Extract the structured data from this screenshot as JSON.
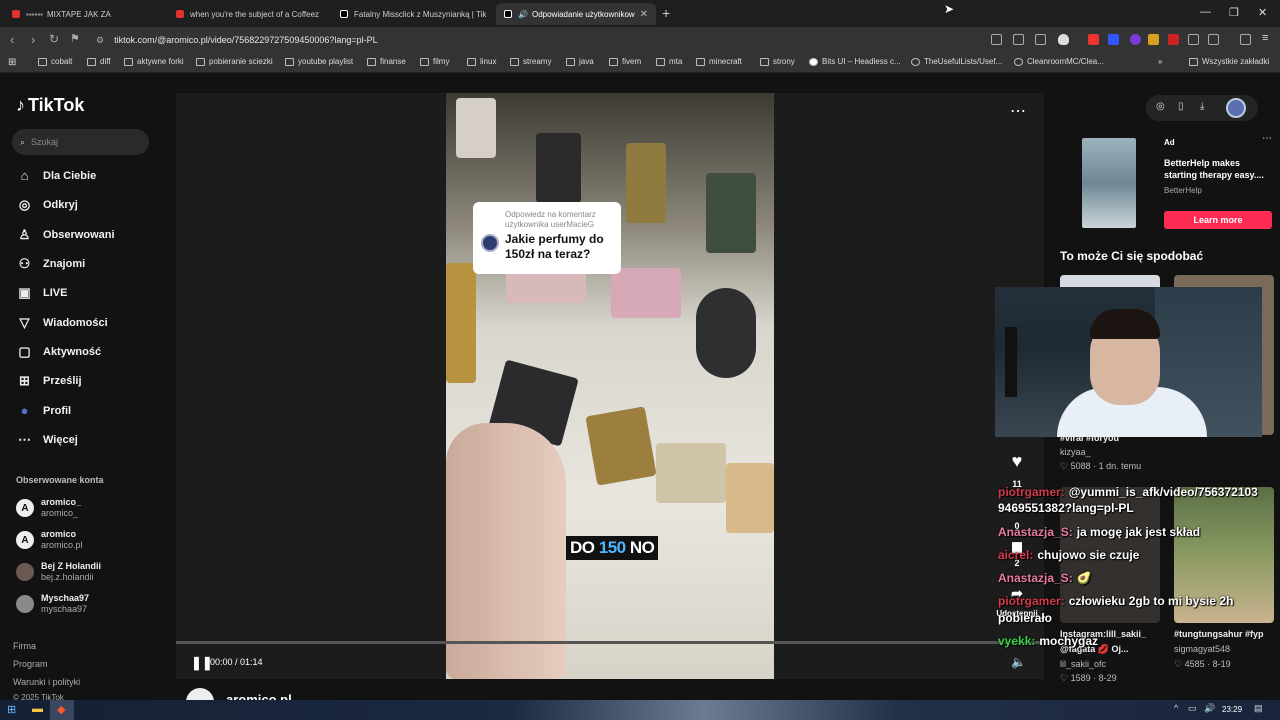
{
  "browser": {
    "tabs": [
      {
        "label": "MIXTAPE JAK ZA",
        "color": "#e03030"
      },
      {
        "label": "when you're the subject of a Coffeez",
        "color": "#e03030"
      },
      {
        "label": "Fatalny Missclick z Muszynianką | Tik",
        "color": "#ffffff"
      },
      {
        "label": "Odpowiadanie użytkownikow",
        "color": "#ffffff"
      }
    ],
    "url": "tiktok.com/@aromico.pl/video/7568229727509450006?lang=pl-PL",
    "bookmarks": [
      "cobalt",
      "diff",
      "aktywne forki",
      "pobieranie sciezki",
      "youtube playlist",
      "finanse",
      "filmy",
      "linux",
      "streamy",
      "java",
      "fivem",
      "mta",
      "minecraft",
      "strony",
      "Bits UI – Headless c...",
      "TheUsefulLists/Usef...",
      "CleanroomMC/Clea..."
    ],
    "bookmarks_all": "Wszystkie zakładki"
  },
  "sidebar": {
    "logo": "TikTok",
    "search_placeholder": "Szukaj",
    "nav": [
      {
        "label": "Dla Ciebie",
        "icon": "home-icon",
        "glyph": "⌂"
      },
      {
        "label": "Odkryj",
        "icon": "compass-icon",
        "glyph": "◎"
      },
      {
        "label": "Obserwowani",
        "icon": "following-icon",
        "glyph": "♙"
      },
      {
        "label": "Znajomi",
        "icon": "friends-icon",
        "glyph": "⚇"
      },
      {
        "label": "LIVE",
        "icon": "live-icon",
        "glyph": "▣"
      },
      {
        "label": "Wiadomości",
        "icon": "messages-icon",
        "glyph": "▽"
      },
      {
        "label": "Aktywność",
        "icon": "activity-icon",
        "glyph": "▢"
      },
      {
        "label": "Prześlij",
        "icon": "upload-icon",
        "glyph": "⊞"
      },
      {
        "label": "Profil",
        "icon": "profile-icon",
        "glyph": "●"
      },
      {
        "label": "Więcej",
        "icon": "more-icon",
        "glyph": "⋯"
      }
    ],
    "following_header": "Obserwowane konta",
    "following": [
      {
        "name": "aromico_",
        "handle": "aromico_"
      },
      {
        "name": "aromico",
        "handle": "aromico.pl"
      },
      {
        "name": "Bej Z Holandii",
        "handle": "bej.z.holandii"
      },
      {
        "name": "Myschaa97",
        "handle": "myschaa97"
      }
    ],
    "footer": [
      "Firma",
      "Program",
      "Warunki i polityki",
      "© 2025 TikTok"
    ]
  },
  "video": {
    "reply_header": "Odpowiedz na komentarz użytkownika userMacieG",
    "reply_question": "Jakie perfumy do 150zł na teraz?",
    "caption_a": "DO ",
    "caption_b": "150",
    "caption_c": " NO",
    "time": "00:00 / 01:14",
    "progress": 0,
    "author": "aromico.pl"
  },
  "actions": {
    "likes": "11",
    "comments": "0",
    "saves": "2",
    "share_label": "Udostępnij"
  },
  "right": {
    "ad_label": "Ad",
    "ad_title": "BetterHelp makes starting therapy easy....",
    "ad_source": "BetterHelp",
    "ad_button": "Learn more",
    "may_like": "To może Ci się spodobać",
    "row1_tag": "#viral #foryou",
    "row1_user": "kizyaa_",
    "row1_stats": "♡ 5088 · 1 dn. temu",
    "row2_left_title": "Instagram:lill_sakii_",
    "row2_left_sub": "@fagata 💋 Oj...",
    "row2_left_user": "lil_sakii_ofc",
    "row2_left_stats": "♡ 1589 · 8-29",
    "row2_right_title": "#tungtungsahur #fyp",
    "row2_right_user": "sigmagyat548",
    "row2_right_stats": "♡ 4585 · 8-19"
  },
  "chat": [
    {
      "user": "piotrgamer:",
      "color": "#d23c4a",
      "msg": "@yummi_is_afk/video/756372103"
    },
    {
      "user": "",
      "color": "#ffffff",
      "msg": "9469551382?lang=pl-PL"
    },
    {
      "user": "Anastazja_S:",
      "color": "#e87aa4",
      "msg": "ja mogę jak jest skład"
    },
    {
      "user": "aicrel:",
      "color": "#d23c4a",
      "msg": "chujowo sie czuje"
    },
    {
      "user": "Anastazja_S:",
      "color": "#e87aa4",
      "msg": "🥑"
    },
    {
      "user": "piotrgamer:",
      "color": "#d23c4a",
      "msg": "człowieku 2gb to mi bysie 2h"
    },
    {
      "user": "",
      "color": "#ffffff",
      "msg": "pobierało"
    },
    {
      "user": "vyekk:",
      "color": "#3bd34a",
      "msg": "mochygaz"
    }
  ],
  "taskbar": {
    "time": "23:29"
  }
}
